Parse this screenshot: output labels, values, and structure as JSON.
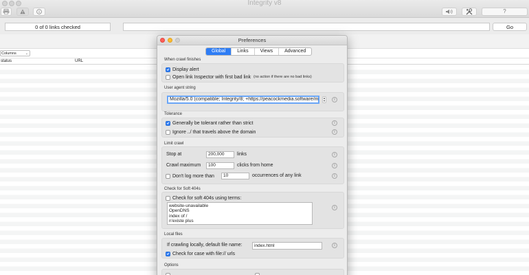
{
  "app": {
    "title": "Integrity v8",
    "links_checked": "0 of 0 links checked",
    "url_value": "",
    "go_label": "Go",
    "columns_label": "Columns",
    "table_headers": [
      "status",
      "URL"
    ]
  },
  "prefs": {
    "title": "Preferences",
    "tabs": [
      {
        "label": "Global",
        "active": true
      },
      {
        "label": "Links",
        "active": false
      },
      {
        "label": "Views",
        "active": false
      },
      {
        "label": "Advanced",
        "active": false
      }
    ],
    "when_crawl_finishes": {
      "heading": "When crawl finishes",
      "display_alert": {
        "label": "Display alert",
        "checked": true
      },
      "open_inspector": {
        "label": "Open link Inspector with first bad link",
        "checked": false,
        "note": "(no action if there are no bad links)"
      }
    },
    "user_agent": {
      "heading": "User agent string",
      "value": "Mozilla/5.0 (compatible; Integrity/8; +https://peacockmedia.software/mac/integrity"
    },
    "tolerance": {
      "heading": "Tolerance",
      "tolerant": {
        "label": "Generally be tolerant rather than strict",
        "checked": true
      },
      "ignore_above": {
        "label": "Ignore ../ that travels above the domain",
        "checked": false
      }
    },
    "limit_crawl": {
      "heading": "Limit crawl",
      "stop_at": {
        "label": "Stop at",
        "value": "200,000",
        "unit": "links"
      },
      "crawl_max": {
        "label": "Crawl maximum",
        "value": "100",
        "unit": "clicks from home"
      },
      "dont_log": {
        "label": "Don't log more than",
        "value": "10",
        "unit": "occurrences of any link",
        "checked": false
      }
    },
    "soft_404": {
      "heading": "Check for Soft 404s",
      "check": {
        "label": "Check for soft 404s using terms:",
        "checked": false
      },
      "terms": [
        "website-unavailable",
        "OpenDNS",
        "index of /",
        "n'existe plus"
      ]
    },
    "local_files": {
      "heading": "Local files",
      "default_name_label": "If crawling locally, default file name:",
      "default_name_value": "index.html",
      "case_check": {
        "label": "Check for case with file:// urls",
        "checked": true
      }
    },
    "options": {
      "heading": "Options"
    }
  },
  "colors": {
    "accent": "#2e7df5",
    "close": "#ff5f57",
    "minimize": "#febc2e",
    "zoom": "#d0d0d0"
  },
  "icons": [
    "printer-icon",
    "warning-icon",
    "info-icon",
    "speaker-icon",
    "tools-icon",
    "help-icon",
    "info-icon"
  ]
}
